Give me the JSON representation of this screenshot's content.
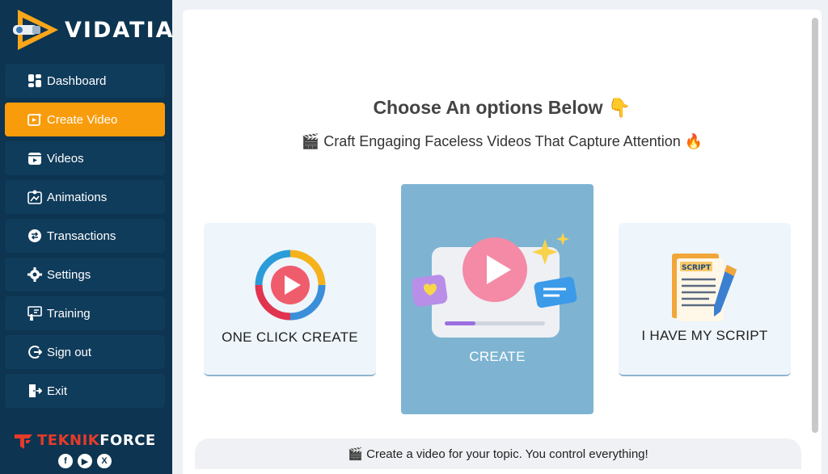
{
  "app": {
    "name": "VIDATIA"
  },
  "sidebar": {
    "items": [
      {
        "label": "Dashboard",
        "icon": "dashboard-icon"
      },
      {
        "label": "Create Video",
        "icon": "create-video-icon",
        "active": true
      },
      {
        "label": "Videos",
        "icon": "videos-icon"
      },
      {
        "label": "Animations",
        "icon": "animations-icon"
      },
      {
        "label": "Transactions",
        "icon": "transactions-icon"
      },
      {
        "label": "Settings",
        "icon": "gear-icon"
      },
      {
        "label": "Training",
        "icon": "training-icon"
      },
      {
        "label": "Sign out",
        "icon": "sign-out-icon"
      },
      {
        "label": "Exit",
        "icon": "exit-icon"
      }
    ],
    "footer": {
      "brand_a": "TEKNIK",
      "brand_b": "FORCE",
      "social": [
        "f",
        "▶",
        "X"
      ]
    }
  },
  "main": {
    "heading": "Choose An options Below 👇",
    "subheading": "🎬 Craft Engaging Faceless Videos That Capture Attention 🔥",
    "cards": [
      {
        "label": "ONE CLICK CREATE"
      },
      {
        "label": "CREATE",
        "selected": true
      },
      {
        "label": "I HAVE MY SCRIPT",
        "badge": "SCRIPT"
      }
    ],
    "hint": "🎬 Create a video for your topic. You control everything!"
  },
  "colors": {
    "sidebar_bg": "#0d3450",
    "nav_item_bg": "#103c5b",
    "active": "#f99c0c",
    "selected_card": "#7eb4d2",
    "card_bg": "#eef5fb"
  }
}
